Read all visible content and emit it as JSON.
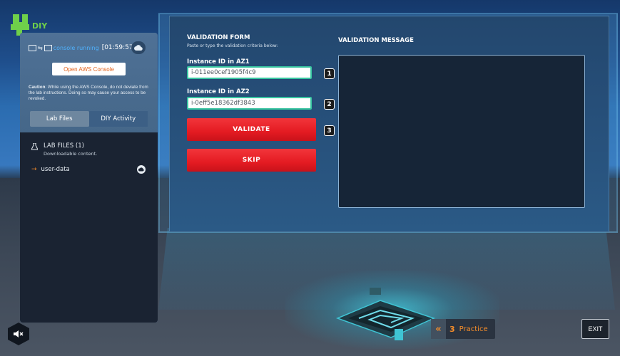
{
  "brand": {
    "label": "DIY"
  },
  "sidebar": {
    "console_status": "console running",
    "timer": "[01:59:57]",
    "open_console_label": "Open AWS Console",
    "caution_prefix": "Caution",
    "caution_text": ": While using the AWS Console, do not deviate from the lab instructions. Doing so may cause your access to be revoked.",
    "tabs": [
      {
        "label": "Lab Files",
        "active": true
      },
      {
        "label": "DIY Activity",
        "active": false
      }
    ],
    "lab_files": {
      "title": "LAB FILES (1)",
      "subtitle": "Downloadable content.",
      "files": [
        {
          "name": "user-data"
        }
      ]
    }
  },
  "form": {
    "title": "VALIDATION FORM",
    "subtitle": "Paste or type the validation criteria below:",
    "fields": [
      {
        "label": "Instance ID in AZ1",
        "value": "i-011ee0cef1905f4c9",
        "step": "1"
      },
      {
        "label": "Instance ID in AZ2",
        "value": "i-0eff5e18362df3843",
        "step": "2"
      }
    ],
    "validate_label": "VALIDATE",
    "validate_step": "3",
    "skip_label": "SKIP"
  },
  "message": {
    "title": "VALIDATION MESSAGE",
    "content": ""
  },
  "footer": {
    "practice_chevron": "«",
    "practice_number": "3",
    "practice_label": "Practice",
    "exit_label": "EXIT"
  },
  "colors": {
    "accent_orange": "#f58d2a",
    "validate_red": "#e41b22",
    "field_border": "#37c5a0",
    "logo_green": "#6fd04a",
    "running_blue": "#4fb3ff"
  }
}
